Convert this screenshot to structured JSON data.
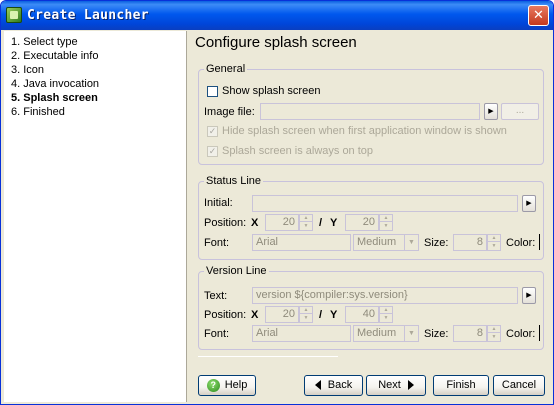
{
  "window": {
    "title": "Create Launcher",
    "close_glyph": "✕",
    "icon": "app-icon"
  },
  "steps": [
    {
      "label": "1. Select type",
      "active": false
    },
    {
      "label": "2. Executable info",
      "active": false
    },
    {
      "label": "3. Icon",
      "active": false
    },
    {
      "label": "4. Java invocation",
      "active": false
    },
    {
      "label": "5. Splash screen",
      "active": true
    },
    {
      "label": "6. Finished",
      "active": false
    }
  ],
  "main": {
    "heading": "Configure splash screen",
    "general": {
      "title": "General",
      "show_splash_label": "Show splash screen",
      "show_splash_checked": false,
      "image_file_label": "Image file:",
      "image_file_value": "",
      "browse_label": "...",
      "hide_splash_label": "Hide splash screen when first application window is shown",
      "hide_splash_checked": true,
      "always_on_top_label": "Splash screen is always on top",
      "always_on_top_checked": true
    },
    "status_line": {
      "title": "Status Line",
      "initial_label": "Initial:",
      "initial_value": "",
      "position_label": "Position:",
      "x_label": "X",
      "x_value": "20",
      "slash": "/",
      "y_label": "Y",
      "y_value": "20",
      "font_label": "Font:",
      "font_value": "Arial",
      "weight_value": "Medium",
      "size_label": "Size:",
      "size_value": "8",
      "color_label": "Color:"
    },
    "version_line": {
      "title": "Version Line",
      "text_label": "Text:",
      "text_value": "version ${compiler:sys.version}",
      "position_label": "Position:",
      "x_label": "X",
      "x_value": "20",
      "slash": "/",
      "y_label": "Y",
      "y_value": "40",
      "font_label": "Font:",
      "font_value": "Arial",
      "weight_value": "Medium",
      "size_label": "Size:",
      "size_value": "8",
      "color_label": "Color:"
    }
  },
  "buttons": {
    "help": "Help",
    "back": "Back",
    "next": "Next",
    "finish": "Finish",
    "cancel": "Cancel"
  },
  "icons": {
    "arrow_right": "▶",
    "spin_up": "▲",
    "spin_down": "▼",
    "combo_down": "▼",
    "check_mark": "✓",
    "help": "?"
  },
  "colors": {
    "titlebar": "#0058ee",
    "frame": "#ece9d8",
    "disabled_text": "#aca899"
  }
}
